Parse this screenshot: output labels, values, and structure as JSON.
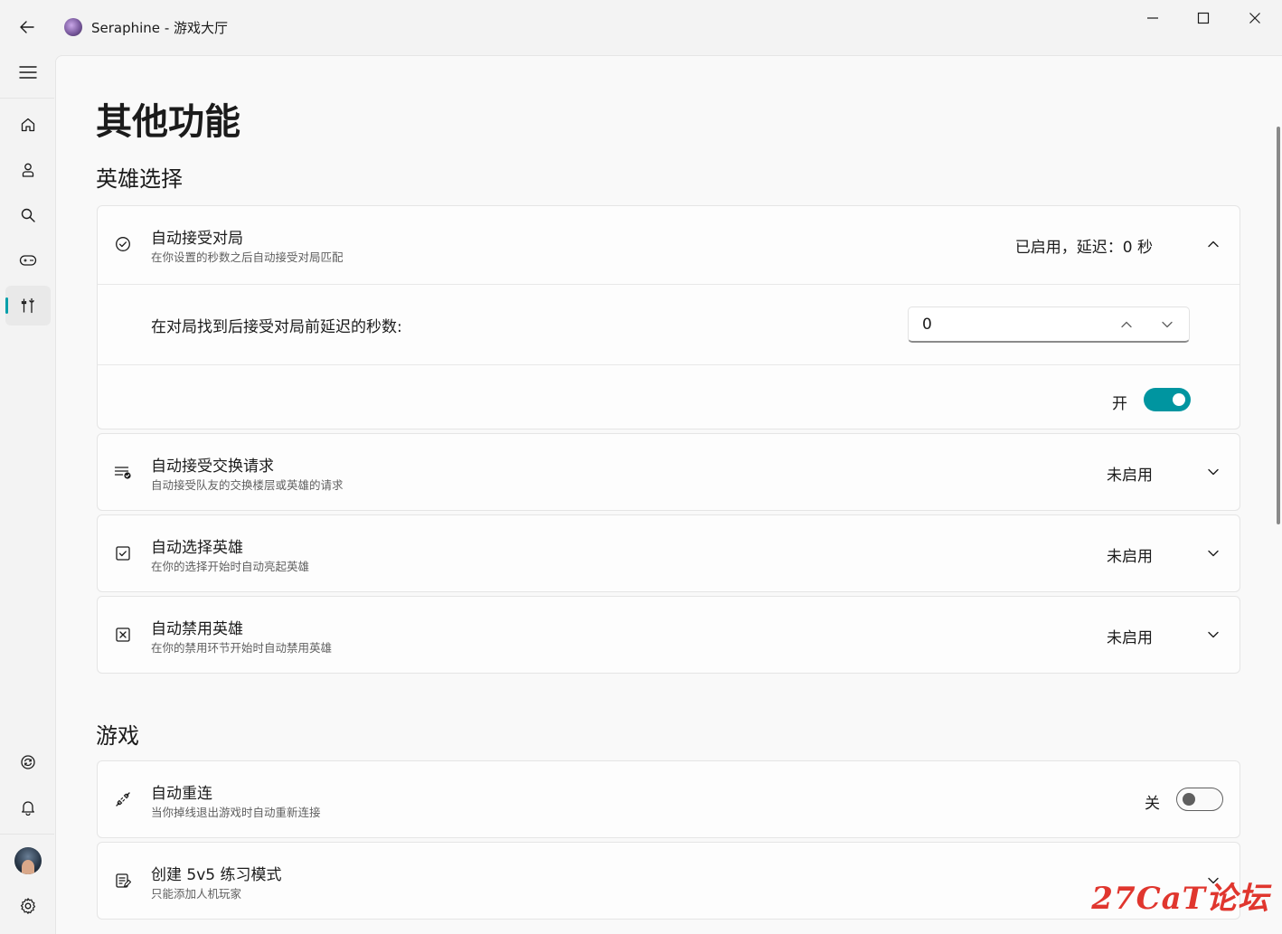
{
  "window": {
    "app_name": "Seraphine",
    "title_sep": " - ",
    "subtitle": "游戏大厅"
  },
  "page": {
    "title": "其他功能"
  },
  "sections": [
    {
      "title": "英雄选择"
    },
    {
      "title": "游戏"
    }
  ],
  "cards": {
    "auto_accept": {
      "title": "自动接受对局",
      "desc": "在你设置的秒数之后自动接受对局匹配",
      "status": "已启用，延迟：0 秒",
      "delay_label": "在对局找到后接受对局前延迟的秒数:",
      "delay_value": "0",
      "toggle_label": "开",
      "toggle_on": true
    },
    "auto_swap": {
      "title": "自动接受交换请求",
      "desc": "自动接受队友的交换楼层或英雄的请求",
      "status": "未启用"
    },
    "auto_pick": {
      "title": "自动选择英雄",
      "desc": "在你的选择开始时自动亮起英雄",
      "status": "未启用"
    },
    "auto_ban": {
      "title": "自动禁用英雄",
      "desc": "在你的禁用环节开始时自动禁用英雄",
      "status": "未启用"
    },
    "auto_reconnect": {
      "title": "自动重连",
      "desc": "当你掉线退出游戏时自动重新连接",
      "toggle_label": "关",
      "toggle_on": false
    },
    "practice_5v5": {
      "title": "创建 5v5 练习模式",
      "desc": "只能添加人机玩家"
    }
  },
  "accent_color": "#009faa",
  "watermark": "27CaT论坛"
}
